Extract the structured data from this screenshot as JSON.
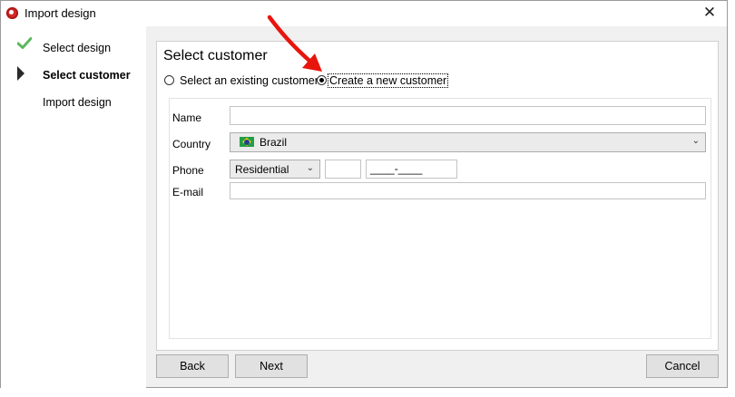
{
  "window": {
    "title": "Import design",
    "close_glyph": "✕",
    "app_icon": "app-logo-icon"
  },
  "wizard": {
    "steps": [
      {
        "label": "Select design",
        "state": "done",
        "icon": "check-icon"
      },
      {
        "label": "Select customer",
        "state": "current",
        "icon": "current-step-icon"
      },
      {
        "label": "Import design",
        "state": "pending"
      }
    ]
  },
  "panel": {
    "title": "Select customer",
    "options": [
      {
        "label": "Select an existing customer",
        "checked": false
      },
      {
        "label": "Create a new customer",
        "checked": true
      }
    ]
  },
  "form": {
    "name_label": "Name",
    "name_value": "",
    "country_label": "Country",
    "country_value": "Brazil",
    "country_flag": "brazil-flag-icon",
    "phone_label": "Phone",
    "phone_type": "Residential",
    "phone_area": "",
    "phone_number_mask": "____-____",
    "email_label": "E-mail",
    "email_value": ""
  },
  "buttons": {
    "back": "Back",
    "next": "Next",
    "cancel": "Cancel"
  },
  "colors": {
    "check": "#5cb85c",
    "arrow": "#e8150c",
    "accent_dark": "#2a2a2a"
  }
}
